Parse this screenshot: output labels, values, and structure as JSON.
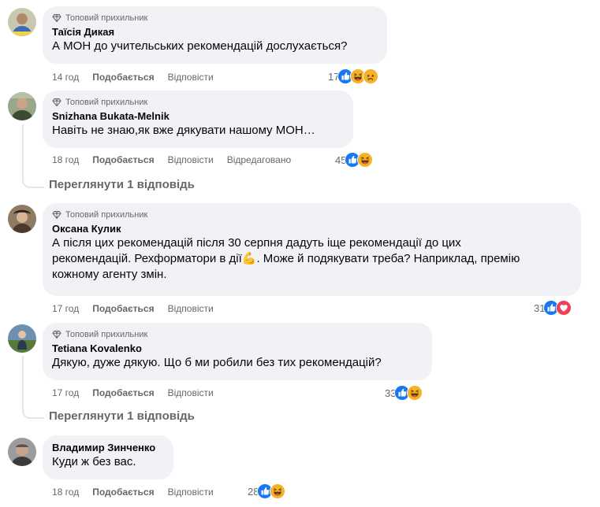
{
  "badge_label": "Топовий прихильник",
  "comments": [
    {
      "author": "Таїсія Дикая",
      "text": "А МОН до учительських рекомендацій дослухається?",
      "time": "14 год",
      "like": "Подобається",
      "reply": "Відповісти",
      "edited": "",
      "count": "17",
      "avatar_color": "#8a9a6a"
    },
    {
      "author": "Snizhana Bukata-Melnik",
      "text": "Навіть не знаю,як вже дякувати нашому МОН…",
      "time": "18 год",
      "like": "Подобається",
      "reply": "Відповісти",
      "edited": "Відредаговано",
      "count": "45",
      "avatar_color": "#6b7a5c"
    },
    {
      "author": "Оксана Кулик",
      "text": "А після цих рекомендацій після 30 серпня дадуть іще рекомендації до цих рекомендацій. Рехформатори в дії💪. Може й подякувати треба? Наприклад, премію кожному агенту змін.",
      "time": "17 год",
      "like": "Подобається",
      "reply": "Відповісти",
      "edited": "",
      "count": "31",
      "avatar_color": "#5a4a3a"
    },
    {
      "author": "Tetiana Kovalenko",
      "text": "Дякую, дуже дякую. Що б ми робили без тих рекомендацій?",
      "time": "17 год",
      "like": "Подобається",
      "reply": "Відповісти",
      "edited": "",
      "count": "33",
      "avatar_color": "#4d6a8a"
    },
    {
      "author": "Владимир Зинченко",
      "text": "Куди ж без вас.",
      "time": "18 год",
      "like": "Подобається",
      "reply": "Відповісти",
      "edited": "",
      "count": "28",
      "avatar_color": "#7a7a7a"
    }
  ],
  "view_replies_1": "Переглянути 1 відповідь",
  "view_replies_2": "Переглянути 1 відповідь",
  "colors": {
    "like_blue": "#1877f2",
    "love_red": "#f33e58",
    "haha_yellow": "#f7b125",
    "bubble_bg": "#f0f2f5",
    "meta_gray": "#65676b"
  }
}
